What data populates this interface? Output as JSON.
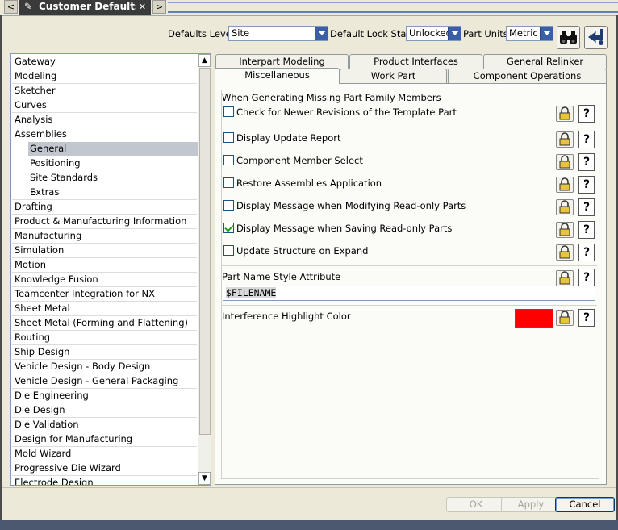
{
  "window": {
    "title": "Customer Defaults"
  },
  "toolbar": {
    "defaults_level_label": "Defaults Level",
    "defaults_level_value": "Site",
    "default_lock_state_label": "Default Lock State",
    "default_lock_state_value": "Unlocked",
    "part_units_label": "Part Units",
    "part_units_value": "Metric"
  },
  "sidebar": {
    "items": [
      {
        "label": "Gateway"
      },
      {
        "label": "Modeling"
      },
      {
        "label": "Sketcher"
      },
      {
        "label": "Curves"
      },
      {
        "label": "Analysis"
      },
      {
        "label": "Assemblies"
      },
      {
        "label": "General"
      },
      {
        "label": "Positioning"
      },
      {
        "label": "Site Standards"
      },
      {
        "label": "Extras"
      },
      {
        "label": "Drafting"
      },
      {
        "label": "Product & Manufacturing Information"
      },
      {
        "label": "Manufacturing"
      },
      {
        "label": "Simulation"
      },
      {
        "label": "Motion"
      },
      {
        "label": "Knowledge Fusion"
      },
      {
        "label": "Teamcenter Integration for NX"
      },
      {
        "label": "Sheet Metal"
      },
      {
        "label": "Sheet Metal (Forming and Flattening)"
      },
      {
        "label": "Routing"
      },
      {
        "label": "Ship Design"
      },
      {
        "label": "Vehicle Design - Body Design"
      },
      {
        "label": "Vehicle Design - General Packaging"
      },
      {
        "label": "Die Engineering"
      },
      {
        "label": "Die Design"
      },
      {
        "label": "Die Validation"
      },
      {
        "label": "Design for Manufacturing"
      },
      {
        "label": "Mold Wizard"
      },
      {
        "label": "Progressive Die Wizard"
      },
      {
        "label": "Electrode Design"
      }
    ]
  },
  "tabs": {
    "row1": [
      {
        "label": "Interpart Modeling"
      },
      {
        "label": "Product Interfaces"
      },
      {
        "label": "General Relinker"
      }
    ],
    "row2": [
      {
        "label": "Miscellaneous"
      },
      {
        "label": "Work Part"
      },
      {
        "label": "Component Operations"
      }
    ]
  },
  "panel": {
    "group_heading": "When Generating Missing Part Family Members",
    "options": [
      {
        "label": "Check for Newer Revisions of the Template Part",
        "checked": false
      },
      {
        "label": "Display Update Report",
        "checked": false
      },
      {
        "label": "Component Member Select",
        "checked": false
      },
      {
        "label": "Restore Assemblies Application",
        "checked": false
      },
      {
        "label": "Display Message when Modifying Read-only Parts",
        "checked": false
      },
      {
        "label": "Display Message when Saving Read-only Parts",
        "checked": true
      },
      {
        "label": "Update Structure on Expand",
        "checked": false
      }
    ],
    "part_name_label": "Part Name Style Attribute",
    "part_name_value": "$FILENAME",
    "interference_label": "Interference Highlight Color",
    "interference_color": "#ff0000",
    "help_glyph": "?"
  },
  "footer": {
    "ok_label": "OK",
    "apply_label": "Apply",
    "cancel_label": "Cancel"
  },
  "icons": {
    "back": "<",
    "forward": ">",
    "close": "✕",
    "wrench": "✎",
    "scroll_up": "▲",
    "scroll_down": "▼"
  }
}
